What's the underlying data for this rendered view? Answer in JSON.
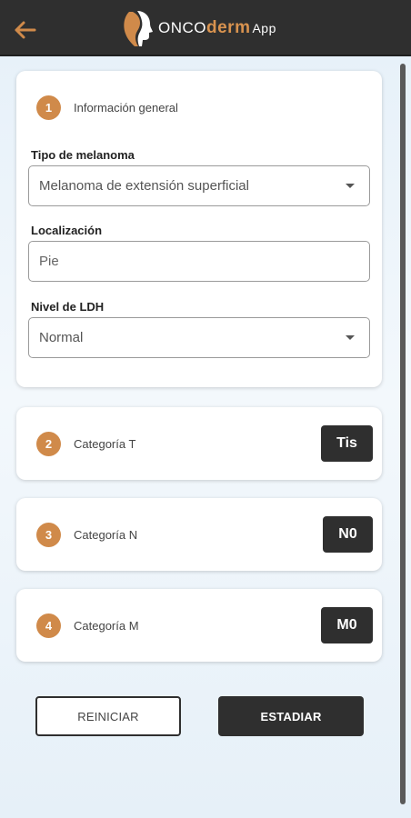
{
  "header": {
    "back_icon": "arrow-left-icon",
    "logo_icon": "head-profile-icon",
    "brand_onco": "ONCO",
    "brand_derm": "derm",
    "brand_app": "App"
  },
  "colors": {
    "topbar": "#2f2f2f",
    "accent": "#d08a4a",
    "background": "#eaf3fa"
  },
  "general": {
    "step": "1",
    "title": "Información general",
    "melanoma_type_label": "Tipo de melanoma",
    "melanoma_type_value": "Melanoma de extensión superficial",
    "location_label": "Localización",
    "location_placeholder": "Pie",
    "ldh_label": "Nivel de LDH",
    "ldh_value": "Normal"
  },
  "categories": [
    {
      "step": "2",
      "title": "Categoría T",
      "value": "Tis"
    },
    {
      "step": "3",
      "title": "Categoría N",
      "value": "N0"
    },
    {
      "step": "4",
      "title": "Categoría M",
      "value": "M0"
    }
  ],
  "actions": {
    "reset_label": "REINICIAR",
    "stage_label": "ESTADIAR"
  }
}
